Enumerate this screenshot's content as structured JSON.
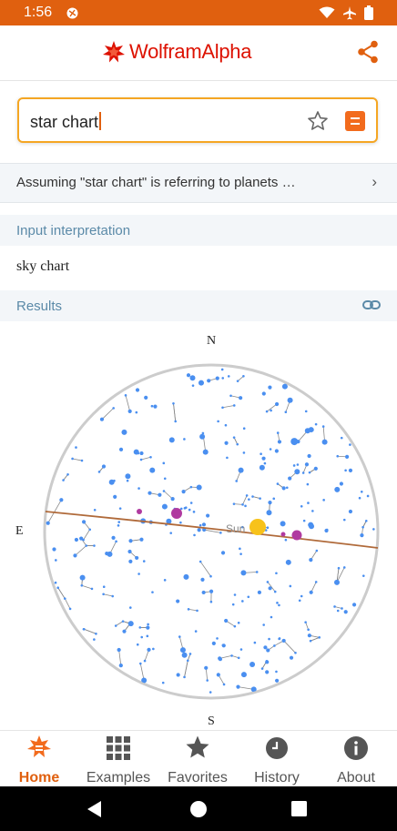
{
  "status_bar": {
    "time": "1:56",
    "icons": [
      "app-notification-icon",
      "wifi-icon",
      "airplane-icon",
      "battery-icon"
    ]
  },
  "header": {
    "logo_text": "WolframAlpha",
    "share_icon": "share-icon"
  },
  "search": {
    "value": "star chart"
  },
  "assumption": {
    "text": "Assuming \"star chart\" is  referring to planets …",
    "chevron": "›"
  },
  "input_interpretation": {
    "header": "Input interpretation",
    "value": "sky chart"
  },
  "results": {
    "header": "Results",
    "link_icon": "link-icon"
  },
  "chart_data": {
    "type": "scatter",
    "directions": {
      "north": "N",
      "south": "S",
      "east": "E"
    },
    "annotations": [
      "Sun"
    ],
    "colors": {
      "stars": "#4a8ff0",
      "constellation_lines": "#888888",
      "ecliptic": "#b06a3a",
      "sun": "#f7c21b",
      "planets": "#b03aa0",
      "horizon": "#cccccc"
    }
  },
  "bottom_nav": {
    "items": [
      {
        "label": "Home",
        "icon": "home-icon",
        "active": true
      },
      {
        "label": "Examples",
        "icon": "grid-icon",
        "active": false
      },
      {
        "label": "Favorites",
        "icon": "star-icon",
        "active": false
      },
      {
        "label": "History",
        "icon": "clock-icon",
        "active": false
      },
      {
        "label": "About",
        "icon": "info-icon",
        "active": false
      }
    ]
  },
  "system_nav": {
    "icons": [
      "back-icon",
      "home-circle-icon",
      "recents-icon"
    ]
  }
}
